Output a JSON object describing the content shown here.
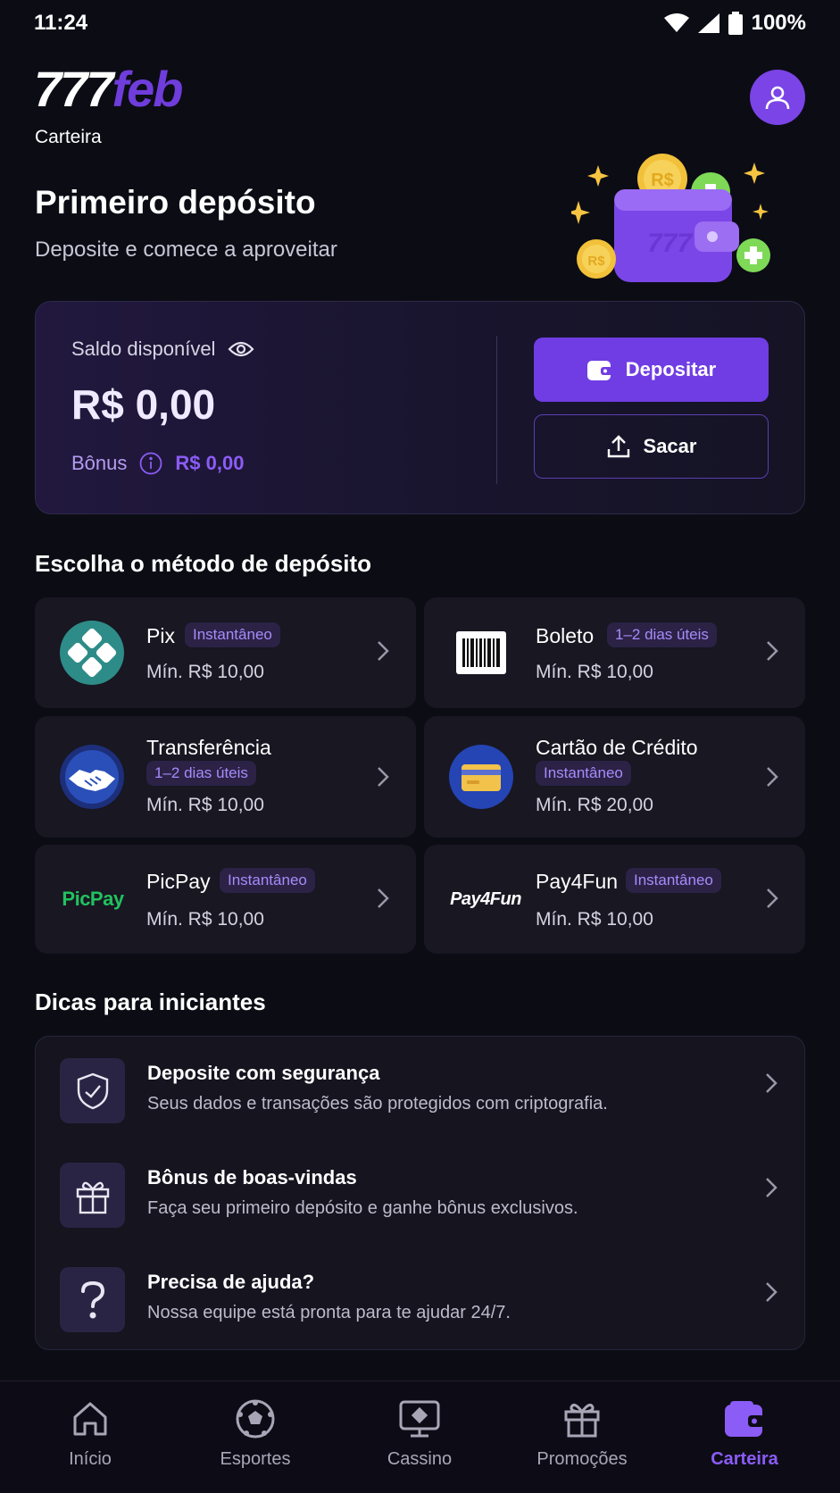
{
  "status_bar": {
    "time": "11:24",
    "battery": "100%"
  },
  "header": {
    "logo_num": "777",
    "logo_word": "feb",
    "section": "Carteira"
  },
  "hero": {
    "title": "Primeiro depósito",
    "subtitle": "Deposite e comece a aproveitar"
  },
  "balance": {
    "label": "Saldo disponível",
    "value": "R$ 0,00",
    "bonus_label": "Bônus",
    "bonus_value": "R$ 0,00",
    "deposit_label": "Depositar",
    "withdraw_label": "Sacar"
  },
  "methods_title": "Escolha o método de depósito",
  "methods": [
    {
      "name": "Pix",
      "badge": "Instantâneo",
      "min": "Mín. R$ 10,00",
      "icon": "pix-icon"
    },
    {
      "name": "Boleto",
      "badge": "1–2 dias úteis",
      "min": "Mín. R$ 10,00",
      "icon": "barcode-icon"
    },
    {
      "name": "Transferência",
      "badge": "1–2 dias úteis",
      "min": "Mín. R$ 10,00",
      "icon": "handshake-icon"
    },
    {
      "name": "Cartão de Crédito",
      "badge": "Instantâneo",
      "min": "Mín. R$ 20,00",
      "icon": "credit-card-icon"
    },
    {
      "name": "PicPay",
      "badge": "Instantâneo",
      "min": "Mín. R$ 10,00",
      "icon": "picpay-logo",
      "logo_text": "PicPay"
    },
    {
      "name": "Pay4Fun",
      "badge": "Instantâneo",
      "min": "Mín. R$ 10,00",
      "icon": "pay4fun-logo",
      "logo_text": "Pay4Fun"
    }
  ],
  "tips_title": "Dicas para iniciantes",
  "tips": [
    {
      "title": "Deposite com segurança",
      "desc": "Seus dados e transações são protegidos com criptografia.",
      "icon": "shield-icon"
    },
    {
      "title": "Bônus de boas-vindas",
      "desc": "Faça seu primeiro depósito e ganhe bônus exclusivos.",
      "icon": "gift-icon"
    },
    {
      "title": "Precisa de ajuda?",
      "desc": "Nossa equipe está pronta para te ajudar 24/7.",
      "icon": "question-icon"
    }
  ],
  "nav": [
    {
      "label": "Início",
      "icon": "home-icon"
    },
    {
      "label": "Esportes",
      "icon": "soccer-ball-icon"
    },
    {
      "label": "Cassino",
      "icon": "casino-icon"
    },
    {
      "label": "Promoções",
      "icon": "gift-icon"
    },
    {
      "label": "Carteira",
      "icon": "wallet-icon",
      "active": true
    }
  ],
  "colors": {
    "accent": "#6f3de3",
    "accent_text": "#8b5cf6",
    "background": "#0c0c15",
    "card": "#181722"
  }
}
